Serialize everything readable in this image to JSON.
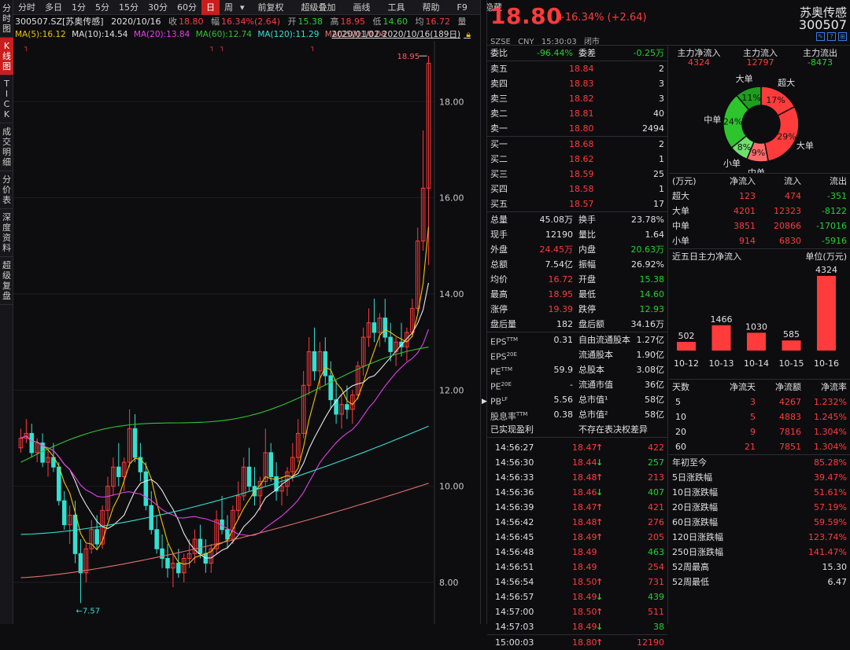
{
  "left_nav": [
    {
      "label": "分时图",
      "active": false
    },
    {
      "label": "K线图",
      "active": true
    },
    {
      "label": "TICK",
      "active": false
    },
    {
      "label": "成交明细",
      "active": false
    },
    {
      "label": "分价表",
      "active": false
    },
    {
      "label": "深度资料",
      "active": false
    },
    {
      "label": "超级复盘",
      "active": false
    }
  ],
  "toolbar": {
    "periods": [
      "分时",
      "多日",
      "1分",
      "5分",
      "15分",
      "30分",
      "60分",
      "日",
      "周"
    ],
    "active_period": "日",
    "more": "▾",
    "tools": [
      "前复权",
      "超级叠加",
      "画线",
      "工具",
      "帮助",
      "F9",
      "隐藏"
    ]
  },
  "info": {
    "code": "300507.SZ[苏奥传感]",
    "date": "2020/10/16",
    "close_label": "收",
    "close": "18.80",
    "range_label": "幅",
    "range": "16.34%(2.64)",
    "open_label": "开",
    "open": "15.38",
    "high_label": "高",
    "high": "18.95",
    "low_label": "低",
    "low": "14.60",
    "avg_label": "均",
    "avg": "16.72",
    "vol_label": "量"
  },
  "ma": {
    "ma5": "MA(5):16.12",
    "ma10": "MA(10):14.54",
    "ma20": "MA(20):13.84",
    "ma60": "MA(60):12.74",
    "ma120": "MA(120):11.29",
    "ma250": "MA(250):10.08",
    "range": "2020/01/02-2020/10/16(189日)"
  },
  "chart_data": {
    "type": "candlestick",
    "x_range": [
      "2020/01/02",
      "2020/10/16"
    ],
    "y_ticks": [
      "8.00",
      "10.00",
      "12.00",
      "14.00",
      "16.00",
      "18.00"
    ],
    "ylim": [
      7.2,
      19.1
    ],
    "max_label": "18.95",
    "min_label": "7.57",
    "series": [
      {
        "name": "MA(5)",
        "color": "#f2c200"
      },
      {
        "name": "MA(10)",
        "color": "#e8e8e8"
      },
      {
        "name": "MA(20)",
        "color": "#e040e0"
      },
      {
        "name": "MA(60)",
        "color": "#33c133"
      },
      {
        "name": "MA(120)",
        "color": "#34e0d0"
      },
      {
        "name": "MA(250)",
        "color": "#e07070"
      }
    ],
    "candles_ohlc": [
      [
        10.8,
        11.2,
        10.7,
        11.0
      ],
      [
        11.0,
        11.4,
        10.9,
        11.1
      ],
      [
        11.1,
        11.3,
        10.6,
        10.7
      ],
      [
        10.7,
        11.0,
        10.5,
        10.9
      ],
      [
        10.9,
        11.1,
        10.4,
        10.5
      ],
      [
        10.5,
        10.8,
        10.2,
        10.6
      ],
      [
        10.6,
        10.9,
        10.3,
        10.4
      ],
      [
        10.4,
        10.5,
        9.6,
        9.7
      ],
      [
        9.7,
        9.9,
        9.1,
        9.2
      ],
      [
        9.2,
        9.6,
        8.8,
        9.4
      ],
      [
        9.4,
        9.7,
        8.4,
        8.6
      ],
      [
        8.6,
        8.9,
        7.57,
        8.2
      ],
      [
        8.2,
        8.8,
        8.0,
        8.7
      ],
      [
        8.7,
        9.3,
        8.6,
        9.1
      ],
      [
        9.1,
        9.4,
        8.7,
        8.8
      ],
      [
        8.8,
        9.6,
        8.7,
        9.5
      ],
      [
        9.5,
        10.2,
        9.3,
        10.0
      ],
      [
        10.0,
        10.6,
        9.8,
        10.4
      ],
      [
        10.4,
        10.9,
        10.0,
        10.2
      ],
      [
        10.2,
        10.6,
        9.9,
        10.5
      ],
      [
        10.5,
        11.6,
        10.4,
        11.2
      ],
      [
        11.2,
        11.5,
        10.5,
        10.6
      ],
      [
        10.6,
        10.9,
        10.1,
        10.3
      ],
      [
        10.3,
        10.5,
        9.5,
        9.6
      ],
      [
        9.6,
        9.9,
        9.0,
        9.1
      ],
      [
        9.1,
        9.4,
        8.6,
        8.7
      ],
      [
        8.7,
        9.0,
        8.3,
        8.5
      ],
      [
        8.5,
        8.8,
        8.1,
        8.3
      ],
      [
        8.3,
        8.6,
        7.9,
        8.4
      ],
      [
        8.4,
        8.7,
        8.1,
        8.2
      ],
      [
        8.2,
        8.6,
        8.0,
        8.5
      ],
      [
        8.5,
        8.9,
        8.3,
        8.6
      ],
      [
        8.6,
        9.1,
        8.4,
        8.9
      ],
      [
        8.9,
        9.2,
        8.5,
        8.6
      ],
      [
        8.6,
        8.9,
        8.2,
        8.4
      ],
      [
        8.4,
        8.8,
        8.2,
        8.7
      ],
      [
        8.7,
        9.5,
        8.6,
        9.3
      ],
      [
        9.3,
        9.8,
        9.0,
        9.1
      ],
      [
        9.1,
        9.4,
        8.7,
        8.9
      ],
      [
        8.9,
        9.6,
        8.8,
        9.5
      ],
      [
        9.5,
        10.1,
        9.3,
        9.8
      ],
      [
        9.8,
        10.6,
        9.7,
        10.4
      ],
      [
        10.4,
        10.8,
        9.9,
        10.0
      ],
      [
        10.0,
        10.4,
        9.6,
        9.8
      ],
      [
        9.8,
        10.2,
        9.5,
        10.1
      ],
      [
        10.1,
        11.2,
        10.0,
        10.7
      ],
      [
        10.7,
        10.9,
        10.1,
        10.2
      ],
      [
        10.2,
        10.5,
        9.7,
        9.9
      ],
      [
        9.9,
        10.2,
        9.6,
        10.0
      ],
      [
        10.0,
        10.4,
        9.8,
        10.3
      ],
      [
        10.3,
        10.9,
        10.1,
        10.6
      ],
      [
        10.6,
        11.4,
        10.5,
        11.1
      ],
      [
        11.1,
        12.4,
        11.0,
        12.1
      ],
      [
        12.1,
        13.1,
        11.9,
        12.8
      ],
      [
        12.8,
        13.3,
        12.2,
        12.4
      ],
      [
        12.4,
        13.0,
        12.0,
        12.8
      ],
      [
        12.8,
        13.1,
        12.1,
        12.3
      ],
      [
        12.3,
        12.6,
        11.6,
        11.8
      ],
      [
        11.8,
        12.2,
        11.3,
        11.5
      ],
      [
        11.5,
        11.9,
        11.2,
        11.7
      ],
      [
        11.7,
        12.1,
        11.4,
        11.6
      ],
      [
        11.6,
        12.0,
        11.3,
        11.9
      ],
      [
        11.9,
        12.6,
        11.8,
        12.5
      ],
      [
        12.5,
        13.3,
        12.3,
        13.1
      ],
      [
        13.1,
        13.7,
        12.9,
        13.4
      ],
      [
        13.4,
        13.9,
        13.0,
        13.2
      ],
      [
        13.2,
        13.6,
        12.9,
        13.5
      ],
      [
        13.5,
        13.9,
        13.0,
        13.1
      ],
      [
        13.1,
        13.4,
        12.6,
        12.8
      ],
      [
        12.8,
        13.1,
        12.5,
        13.0
      ],
      [
        13.0,
        13.4,
        12.7,
        12.9
      ],
      [
        12.9,
        13.3,
        12.6,
        13.2
      ],
      [
        13.2,
        13.9,
        13.1,
        13.7
      ],
      [
        13.7,
        15.38,
        13.6,
        15.1
      ],
      [
        15.1,
        17.4,
        14.9,
        16.2
      ],
      [
        16.2,
        18.95,
        14.6,
        18.8
      ]
    ]
  },
  "quote": {
    "price": "18.80",
    "change": "+16.34%  (+2.64)",
    "exchange": "SZSE",
    "currency": "CNY",
    "time": "15:30:03",
    "status": "闭市",
    "name": "苏奥传感",
    "code": "300507"
  },
  "weibi": {
    "label1": "委比",
    "val1": "-96.44%",
    "label2": "委差",
    "val2": "-0.25万"
  },
  "asks": [
    {
      "label": "卖五",
      "price": "18.84",
      "vol": "2"
    },
    {
      "label": "卖四",
      "price": "18.83",
      "vol": "3"
    },
    {
      "label": "卖三",
      "price": "18.82",
      "vol": "3"
    },
    {
      "label": "卖二",
      "price": "18.81",
      "vol": "40"
    },
    {
      "label": "卖一",
      "price": "18.80",
      "vol": "2494"
    }
  ],
  "bids": [
    {
      "label": "买一",
      "price": "18.68",
      "vol": "2"
    },
    {
      "label": "买二",
      "price": "18.62",
      "vol": "1"
    },
    {
      "label": "买三",
      "price": "18.59",
      "vol": "25"
    },
    {
      "label": "买四",
      "price": "18.58",
      "vol": "1"
    },
    {
      "label": "买五",
      "price": "18.57",
      "vol": "17"
    }
  ],
  "stats": [
    {
      "l1": "总量",
      "v1": "45.08万",
      "c1": "wh",
      "l2": "换手",
      "v2": "23.78%",
      "c2": "wh"
    },
    {
      "l1": "现手",
      "v1": "12190",
      "c1": "wh",
      "l2": "量比",
      "v2": "1.64",
      "c2": "wh"
    },
    {
      "l1": "外盘",
      "v1": "24.45万",
      "c1": "up",
      "l2": "内盘",
      "v2": "20.63万",
      "c2": "dn"
    },
    {
      "l1": "总额",
      "v1": "7.54亿",
      "c1": "wh",
      "l2": "振幅",
      "v2": "26.92%",
      "c2": "wh"
    },
    {
      "l1": "均价",
      "v1": "16.72",
      "c1": "up",
      "l2": "开盘",
      "v2": "15.38",
      "c2": "dn"
    },
    {
      "l1": "最高",
      "v1": "18.95",
      "c1": "up",
      "l2": "最低",
      "v2": "14.60",
      "c2": "dn"
    },
    {
      "l1": "涨停",
      "v1": "19.39",
      "c1": "up",
      "l2": "跌停",
      "v2": "12.93",
      "c2": "dn"
    },
    {
      "l1": "盘后量",
      "v1": "182",
      "c1": "wh",
      "l2": "盘后额",
      "v2": "34.16万",
      "c2": "wh"
    }
  ],
  "fund": [
    {
      "l1": "EPS",
      "s1": "TTM",
      "v1": "0.31",
      "l2": "自由流通股本",
      "v2": "1.27亿"
    },
    {
      "l1": "EPS",
      "s1": "20E",
      "v1": "",
      "l2": "流通股本",
      "v2": "1.90亿"
    },
    {
      "l1": "PE",
      "s1": "TTM",
      "v1": "59.9",
      "l2": "总股本",
      "v2": "3.08亿"
    },
    {
      "l1": "PE",
      "s1": "20E",
      "v1": "-",
      "l2": "流通市值",
      "v2": "36亿"
    },
    {
      "l1": "PB",
      "s1": "LF",
      "v1": "5.56",
      "l2": "总市值¹",
      "v2": "58亿"
    },
    {
      "l1": "股息率",
      "s1": "TTM",
      "v1": "0.38",
      "l2": "总市值²",
      "v2": "58亿"
    }
  ],
  "fund_note": {
    "left": "已实现盈利",
    "right": "不存在表决权差异"
  },
  "ticks": [
    {
      "t": "14:56:27",
      "p": "18.47",
      "d": "up",
      "v": "422",
      "vc": "up"
    },
    {
      "t": "14:56:30",
      "p": "18.44",
      "d": "dn",
      "v": "257",
      "vc": "dn"
    },
    {
      "t": "14:56:33",
      "p": "18.48",
      "d": "up",
      "v": "213",
      "vc": "up"
    },
    {
      "t": "14:56:36",
      "p": "18.46",
      "d": "dn",
      "v": "407",
      "vc": "dn"
    },
    {
      "t": "14:56:39",
      "p": "18.47",
      "d": "up",
      "v": "421",
      "vc": "up"
    },
    {
      "t": "14:56:42",
      "p": "18.48",
      "d": "up",
      "v": "276",
      "vc": "up"
    },
    {
      "t": "14:56:45",
      "p": "18.49",
      "d": "up",
      "v": "205",
      "vc": "up"
    },
    {
      "t": "14:56:48",
      "p": "18.49",
      "d": "",
      "v": "463",
      "vc": "dn"
    },
    {
      "t": "14:56:51",
      "p": "18.49",
      "d": "",
      "v": "254",
      "vc": "up"
    },
    {
      "t": "14:56:54",
      "p": "18.50",
      "d": "up",
      "v": "731",
      "vc": "up"
    },
    {
      "t": "14:56:57",
      "p": "18.49",
      "d": "dn",
      "v": "439",
      "vc": "dn"
    },
    {
      "t": "14:57:00",
      "p": "18.50",
      "d": "up",
      "v": "511",
      "vc": "up"
    },
    {
      "t": "14:57:03",
      "p": "18.49",
      "d": "dn",
      "v": "38",
      "vc": "dn"
    },
    {
      "t": "15:00:03",
      "p": "18.80",
      "d": "up",
      "v": "12190",
      "vc": "up"
    }
  ],
  "flow_head": {
    "l1": "主力净流入",
    "v1": "4324",
    "l2": "主力流入",
    "v2": "12797",
    "l3": "主力流出",
    "v3": "-8473"
  },
  "donut": {
    "slices": [
      {
        "name": "超大",
        "label": "超大",
        "pct": "17%",
        "value": 17,
        "color": "#ff3b3b"
      },
      {
        "name": "大单",
        "label": "大单",
        "pct": "29%",
        "value": 29,
        "color": "#ff3b3b"
      },
      {
        "name": "中单",
        "label": "中单",
        "pct": "9%",
        "value": 9,
        "color": "#ff6b6b"
      },
      {
        "name": "小单",
        "label": "小单",
        "pct": "8%",
        "value": 8,
        "color": "#6fe06f"
      },
      {
        "name": "中单",
        "label": "中单",
        "pct": "24%",
        "value": 24,
        "color": "#2ec42e"
      },
      {
        "name": "大单",
        "label": "大单",
        "pct": "11%",
        "value": 11,
        "color": "#1e9e1e"
      }
    ]
  },
  "flow_table": {
    "headers": [
      "(万元)",
      "净流入",
      "流入",
      "流出"
    ],
    "rows": [
      {
        "n": "超大",
        "a": "123",
        "b": "474",
        "c": "-351"
      },
      {
        "n": "大单",
        "a": "4201",
        "b": "12323",
        "c": "-8122"
      },
      {
        "n": "中单",
        "a": "3851",
        "b": "20866",
        "c": "-17016"
      },
      {
        "n": "小单",
        "a": "914",
        "b": "6830",
        "c": "-5916"
      }
    ]
  },
  "five_day": {
    "title": "近五日主力净流入",
    "unit": "单位(万元)",
    "categories": [
      "10-12",
      "10-13",
      "10-14",
      "10-15",
      "10-16"
    ],
    "values": [
      502,
      1466,
      1030,
      585,
      4324
    ]
  },
  "days_table": {
    "headers": [
      "天数",
      "净流天",
      "净流额",
      "净流率"
    ],
    "rows": [
      {
        "d": "5",
        "n": "3",
        "a": "4267",
        "r": "1.232%"
      },
      {
        "d": "10",
        "n": "5",
        "a": "4883",
        "r": "1.245%"
      },
      {
        "d": "20",
        "n": "9",
        "a": "7816",
        "r": "1.304%"
      },
      {
        "d": "60",
        "n": "21",
        "a": "7851",
        "r": "1.304%"
      }
    ]
  },
  "perf": [
    {
      "l": "年初至今",
      "v": "85.28%",
      "c": "up"
    },
    {
      "l": "5日涨跌幅",
      "v": "39.47%",
      "c": "up"
    },
    {
      "l": "10日涨跌幅",
      "v": "51.61%",
      "c": "up"
    },
    {
      "l": "20日涨跌幅",
      "v": "57.19%",
      "c": "up"
    },
    {
      "l": "60日涨跌幅",
      "v": "59.59%",
      "c": "up"
    },
    {
      "l": "120日涨跌幅",
      "v": "123.74%",
      "c": "up"
    },
    {
      "l": "250日涨跌幅",
      "v": "141.47%",
      "c": "up"
    },
    {
      "l": "52周最高",
      "v": "15.30",
      "c": "wh"
    },
    {
      "l": "52周最低",
      "v": "6.47",
      "c": "wh"
    }
  ]
}
